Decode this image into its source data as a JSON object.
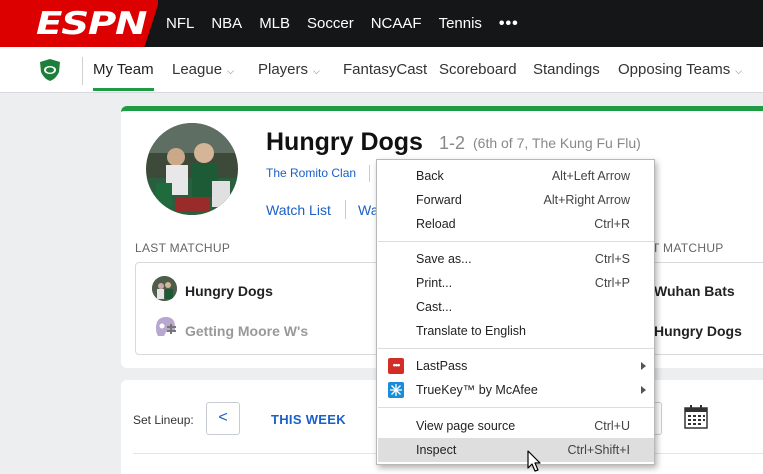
{
  "top_nav": {
    "logo": "ESPN",
    "items": [
      "NFL",
      "NBA",
      "MLB",
      "Soccer",
      "NCAAF",
      "Tennis"
    ],
    "more": "•••"
  },
  "sub_nav": {
    "items": [
      {
        "label": "My Team",
        "dropdown": false,
        "active": true
      },
      {
        "label": "League",
        "dropdown": true
      },
      {
        "label": "Players",
        "dropdown": true
      },
      {
        "label": "FantasyCast",
        "dropdown": false
      },
      {
        "label": "Scoreboard",
        "dropdown": false
      },
      {
        "label": "Standings",
        "dropdown": false
      },
      {
        "label": "Opposing Teams",
        "dropdown": true
      }
    ],
    "chevron": "⌵"
  },
  "team": {
    "name": "Hungry Dogs",
    "record": "1-2",
    "rank": "(6th of 7, The Kung Fu Flu)",
    "owner": "The Romito Clan",
    "watch_list": "Watch List",
    "watch_partial": "Wa"
  },
  "last_matchup": {
    "left_label": "LAST MATCHUP",
    "right_label": "T MATCHUP",
    "left_team1": "Hungry Dogs",
    "left_team2": "Getting Moore W's",
    "right_team1": "Wuhan Bats",
    "right_team2": "Hungry Dogs"
  },
  "lineup": {
    "label": "Set Lineup:",
    "prev": "<",
    "week": "THIS WEEK"
  },
  "context_menu": {
    "items": [
      {
        "label": "Back",
        "shortcut": "Alt+Left Arrow"
      },
      {
        "label": "Forward",
        "shortcut": "Alt+Right Arrow"
      },
      {
        "label": "Reload",
        "shortcut": "Ctrl+R"
      },
      {
        "label": "Save as...",
        "shortcut": "Ctrl+S"
      },
      {
        "label": "Print...",
        "shortcut": "Ctrl+P"
      },
      {
        "label": "Cast...",
        "shortcut": ""
      },
      {
        "label": "Translate to English",
        "shortcut": ""
      },
      {
        "label": "LastPass",
        "shortcut": "",
        "submenu": true,
        "icon": "lastpass-icon"
      },
      {
        "label": "TrueKey™ by McAfee",
        "shortcut": "",
        "submenu": true,
        "icon": "truekey-icon"
      },
      {
        "label": "View page source",
        "shortcut": "Ctrl+U"
      },
      {
        "label": "Inspect",
        "shortcut": "Ctrl+Shift+I",
        "highlighted": true
      }
    ],
    "lastpass_glyph": "•••"
  },
  "colors": {
    "espn_red": "#dd0000",
    "topbar": "#151617",
    "accent_green": "#1e9c43",
    "link_blue": "#1a60c8"
  }
}
